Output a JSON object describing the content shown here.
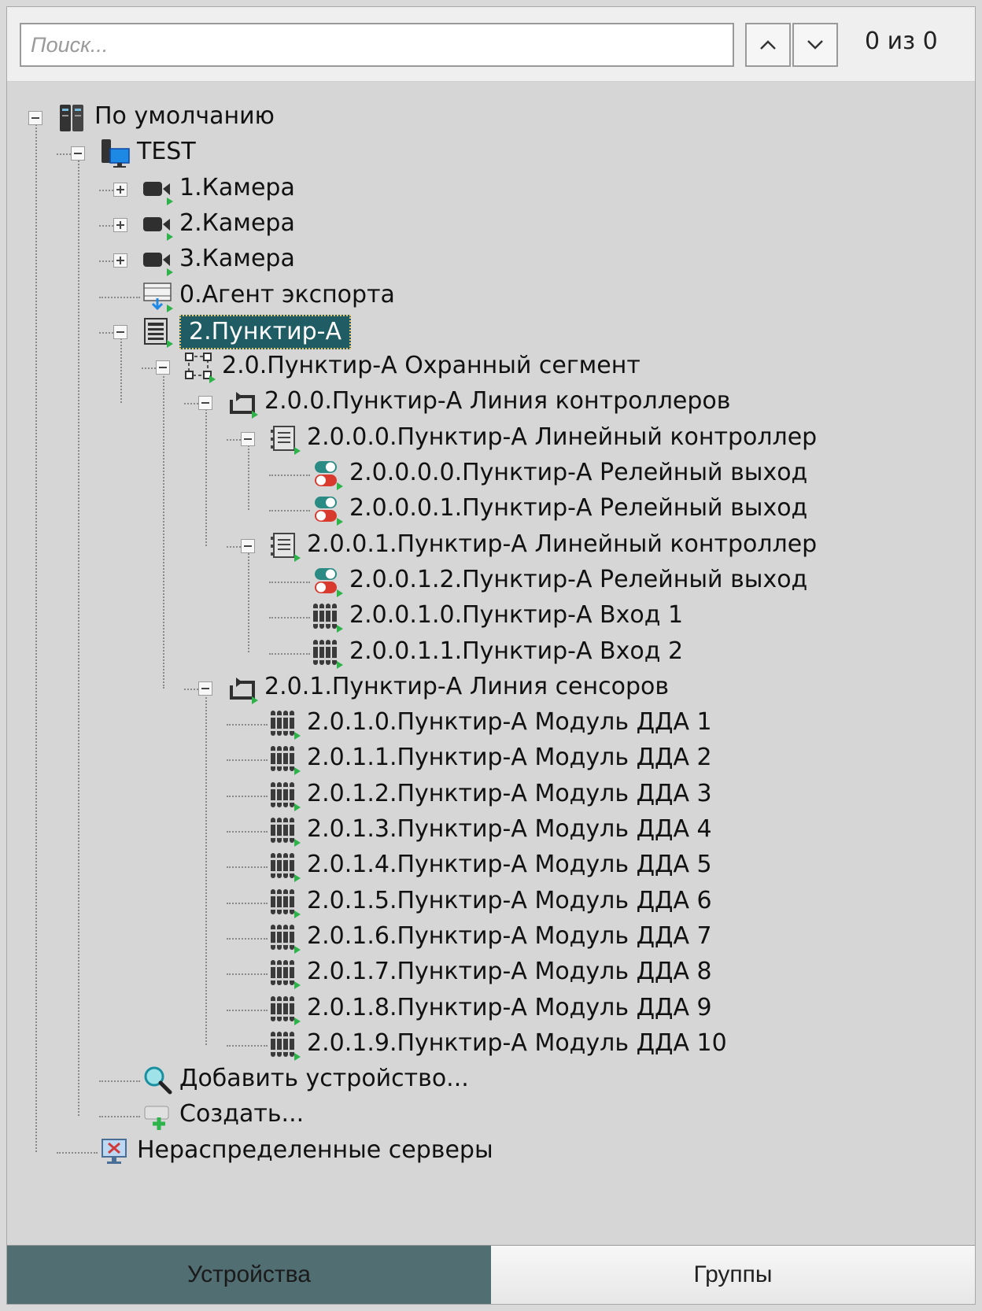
{
  "search": {
    "placeholder": "Поиск...",
    "counter": "0 из 0"
  },
  "tree": [
    {
      "label": "По умолчанию",
      "icon": "server-rack-icon",
      "toggle": "minus"
    },
    {
      "label": "TEST",
      "icon": "server-computer-icon",
      "toggle": "minus"
    },
    {
      "label": "1.Камера",
      "icon": "camera-icon",
      "toggle": "plus"
    },
    {
      "label": "2.Камера",
      "icon": "camera-icon",
      "toggle": "plus"
    },
    {
      "label": "3.Камера",
      "icon": "camera-icon",
      "toggle": "plus"
    },
    {
      "label": "0.Агент экспорта",
      "icon": "export-agent-icon",
      "toggle": "none"
    },
    {
      "label": "2.Пунктир-А",
      "icon": "device-panel-icon",
      "toggle": "minus",
      "selected": true
    },
    {
      "label": "2.0.Пунктир-А Охранный сегмент",
      "icon": "segment-icon",
      "toggle": "minus"
    },
    {
      "label": "2.0.0.Пунктир-А Линия контроллеров",
      "icon": "loop-line-icon",
      "toggle": "minus"
    },
    {
      "label": "2.0.0.0.Пунктир-А Линейный контроллер",
      "icon": "controller-icon",
      "toggle": "minus"
    },
    {
      "label": "2.0.0.0.0.Пунктир-А Релейный выход",
      "icon": "relay-output-icon",
      "toggle": "none"
    },
    {
      "label": "2.0.0.0.1.Пунктир-А Релейный выход",
      "icon": "relay-output-icon",
      "toggle": "none"
    },
    {
      "label": "2.0.0.1.Пунктир-А Линейный контроллер",
      "icon": "controller-icon",
      "toggle": "minus"
    },
    {
      "label": "2.0.0.1.2.Пунктир-А Релейный выход",
      "icon": "relay-output-icon",
      "toggle": "none"
    },
    {
      "label": "2.0.0.1.0.Пунктир-А Вход 1",
      "icon": "input-sensor-icon",
      "toggle": "none"
    },
    {
      "label": "2.0.0.1.1.Пунктир-А Вход 2",
      "icon": "input-sensor-icon",
      "toggle": "none"
    },
    {
      "label": "2.0.1.Пунктир-А Линия сенсоров",
      "icon": "loop-line-icon",
      "toggle": "minus"
    },
    {
      "label": "2.0.1.0.Пунктир-А Модуль ДДА 1",
      "icon": "input-sensor-icon",
      "toggle": "none"
    },
    {
      "label": "2.0.1.1.Пунктир-А Модуль ДДА 2",
      "icon": "input-sensor-icon",
      "toggle": "none"
    },
    {
      "label": "2.0.1.2.Пунктир-А Модуль ДДА 3",
      "icon": "input-sensor-icon",
      "toggle": "none"
    },
    {
      "label": "2.0.1.3.Пунктир-А Модуль ДДА 4",
      "icon": "input-sensor-icon",
      "toggle": "none"
    },
    {
      "label": "2.0.1.4.Пунктир-А Модуль ДДА 5",
      "icon": "input-sensor-icon",
      "toggle": "none"
    },
    {
      "label": "2.0.1.5.Пунктир-А Модуль ДДА 6",
      "icon": "input-sensor-icon",
      "toggle": "none"
    },
    {
      "label": "2.0.1.6.Пунктир-А Модуль ДДА 7",
      "icon": "input-sensor-icon",
      "toggle": "none"
    },
    {
      "label": "2.0.1.7.Пунктир-А Модуль ДДА 8",
      "icon": "input-sensor-icon",
      "toggle": "none"
    },
    {
      "label": "2.0.1.8.Пунктир-А Модуль ДДА 9",
      "icon": "input-sensor-icon",
      "toggle": "none"
    },
    {
      "label": "2.0.1.9.Пунктир-А Модуль ДДА 10",
      "icon": "input-sensor-icon",
      "toggle": "none"
    },
    {
      "label": "Добавить устройство...",
      "icon": "search-add-icon",
      "toggle": "none"
    },
    {
      "label": "Создать...",
      "icon": "create-add-icon",
      "toggle": "none"
    },
    {
      "label": "Нераспределенные серверы",
      "icon": "unassigned-server-icon",
      "toggle": "none"
    }
  ],
  "tabs": [
    {
      "label": "Устройства",
      "active": true
    },
    {
      "label": "Группы",
      "active": false
    }
  ],
  "colors": {
    "selected_bg": "#1f5c63",
    "active_tab": "#516e72",
    "status_green": "#2db34a"
  }
}
